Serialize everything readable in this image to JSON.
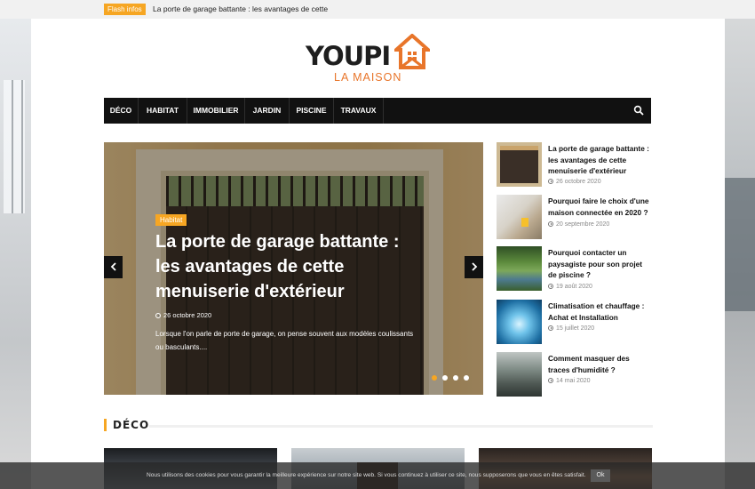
{
  "flash": {
    "tag": "Flash infos",
    "text": "La porte de garage battante : les avantages de cette"
  },
  "logo": {
    "word": "YOUPI",
    "sub": "LA MAISON",
    "colors": {
      "primary": "#1e1e1e",
      "accent": "#e8752a",
      "house": "#e8752a"
    }
  },
  "nav": {
    "items": [
      {
        "label": "DÉCO"
      },
      {
        "label": "HABITAT"
      },
      {
        "label": "IMMOBILIER"
      },
      {
        "label": "JARDIN"
      },
      {
        "label": "PISCINE"
      },
      {
        "label": "TRAVAUX"
      }
    ],
    "search_icon": "search-icon"
  },
  "slider": {
    "badge": "Habitat",
    "title": "La porte de garage battante : les avantages de cette menuiserie d'extérieur",
    "date": "26 octobre 2020",
    "excerpt": "Lorsque l'on parle de porte de garage, on pense souvent aux modèles coulissants ou basculants....",
    "prev_icon": "chevron-left-icon",
    "next_icon": "chevron-right-icon",
    "dots": [
      {
        "active": true
      },
      {
        "active": false
      },
      {
        "active": false
      },
      {
        "active": false
      }
    ],
    "colors": {
      "badge": "#f6a623",
      "dot_active": "#f6a623"
    }
  },
  "posts": [
    {
      "title": "La porte de garage battante : les avantages de cette menuiserie d'extérieur",
      "date": "26 octobre 2020"
    },
    {
      "title": "Pourquoi faire le choix d'une maison connectée en 2020 ?",
      "date": "20 septembre 2020"
    },
    {
      "title": "Pourquoi contacter un paysagiste pour son projet de piscine ?",
      "date": "19 août 2020"
    },
    {
      "title": "Climatisation et chauffage : Achat et Installation",
      "date": "15 juillet 2020"
    },
    {
      "title": "Comment masquer des traces d'humidité ?",
      "date": "14 mai 2020"
    }
  ],
  "section": {
    "title": "DÉCO",
    "accent": "#f6a623"
  },
  "cookie": {
    "text": "Nous utilisons des cookies pour vous garantir la meilleure expérience sur notre site web. Si vous continuez à utiliser ce site, nous supposerons que vous en êtes satisfait.",
    "button": "Ok"
  }
}
